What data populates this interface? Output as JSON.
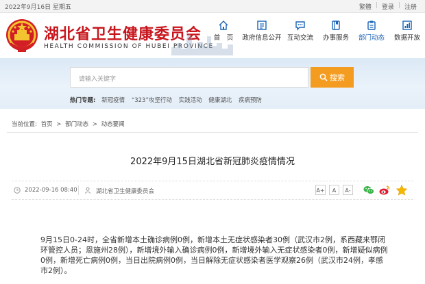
{
  "topbar": {
    "date": "2022年9月16日 星期五",
    "links": [
      "繁體",
      "登录",
      "注册"
    ]
  },
  "header": {
    "title": "湖北省卫生健康委员会",
    "subtitle": "HEALTH COMMISSION OF HUBEI PROVINCE"
  },
  "nav": [
    {
      "label": "首　页",
      "icon": "home-icon",
      "active": false
    },
    {
      "label": "政府信息公开",
      "icon": "info-icon",
      "active": false
    },
    {
      "label": "互动交流",
      "icon": "chat-icon",
      "active": false
    },
    {
      "label": "办事服务",
      "icon": "book-icon",
      "active": false
    },
    {
      "label": "部门动态",
      "icon": "clipboard-icon",
      "active": true
    },
    {
      "label": "数据开放",
      "icon": "data-icon",
      "active": false
    }
  ],
  "search": {
    "placeholder": "请输入关键字",
    "button": "搜索"
  },
  "hot": {
    "label": "热门专题:",
    "items": [
      "新冠疫情",
      "“323”攻坚行动",
      "实践活动",
      "健康湖北",
      "疾病预防"
    ]
  },
  "breadcrumb": {
    "prefix": "当前位置:",
    "items": [
      "首页",
      "部门动态",
      "动态要闻"
    ],
    "sep": ">"
  },
  "article": {
    "title": "2022年9月15日湖北省新冠肺炎疫情情况",
    "datetime": "2022-09-16 08:40",
    "source": "湖北省卫生健康委员会",
    "font_sizes": [
      "A+",
      "A",
      "A-"
    ],
    "body": "9月15日0-24时，全省新增本土确诊病例0例，新增本土无症状感染者30例（武汉市2例，系西藏来鄂闭环管控人员；恩施州28例），新增境外输入确诊病例0例，新增境外输入无症状感染者0例，新增疑似病例0例，新增死亡病例0例，当日出院病例0例，当日解除无症状感染者医学观察26例（武汉市24例，孝感市2例）。"
  },
  "colors": {
    "brand_red": "#c8161d",
    "accent_blue": "#1a63b5",
    "search_orange": "#f49c1f"
  }
}
